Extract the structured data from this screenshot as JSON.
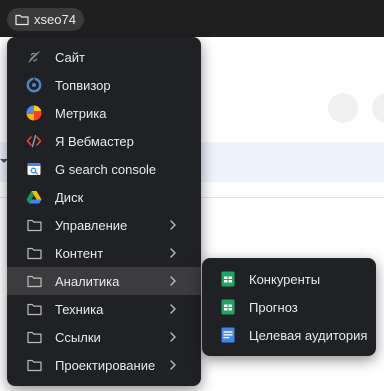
{
  "bookmarks_bar": {
    "folder_label": "xseo74"
  },
  "menu": {
    "items": [
      {
        "label": "Сайт",
        "icon": "site-icon"
      },
      {
        "label": "Топвизор",
        "icon": "topvisor-icon"
      },
      {
        "label": "Метрика",
        "icon": "metrika-icon"
      },
      {
        "label": "Я Вебмастер",
        "icon": "webmaster-icon"
      },
      {
        "label": "G search console",
        "icon": "search-console-icon"
      },
      {
        "label": "Диск",
        "icon": "drive-icon"
      },
      {
        "label": "Управление",
        "icon": "folder-icon"
      },
      {
        "label": "Контент",
        "icon": "folder-icon"
      },
      {
        "label": "Аналитика",
        "icon": "folder-icon"
      },
      {
        "label": "Техника",
        "icon": "folder-icon"
      },
      {
        "label": "Ссылки",
        "icon": "folder-icon"
      },
      {
        "label": "Проектирование",
        "icon": "folder-icon"
      }
    ]
  },
  "submenu": {
    "items": [
      {
        "label": "Конкуренты",
        "icon": "sheets-icon"
      },
      {
        "label": "Прогноз",
        "icon": "sheets-icon"
      },
      {
        "label": "Целевая аудитория",
        "icon": "docs-icon"
      }
    ]
  },
  "colors": {
    "menu_bg": "#202124",
    "active_bg": "#3c3c3f",
    "text": "#e8eaed",
    "sheets_green": "#1fa463",
    "docs_blue": "#4285f4"
  }
}
